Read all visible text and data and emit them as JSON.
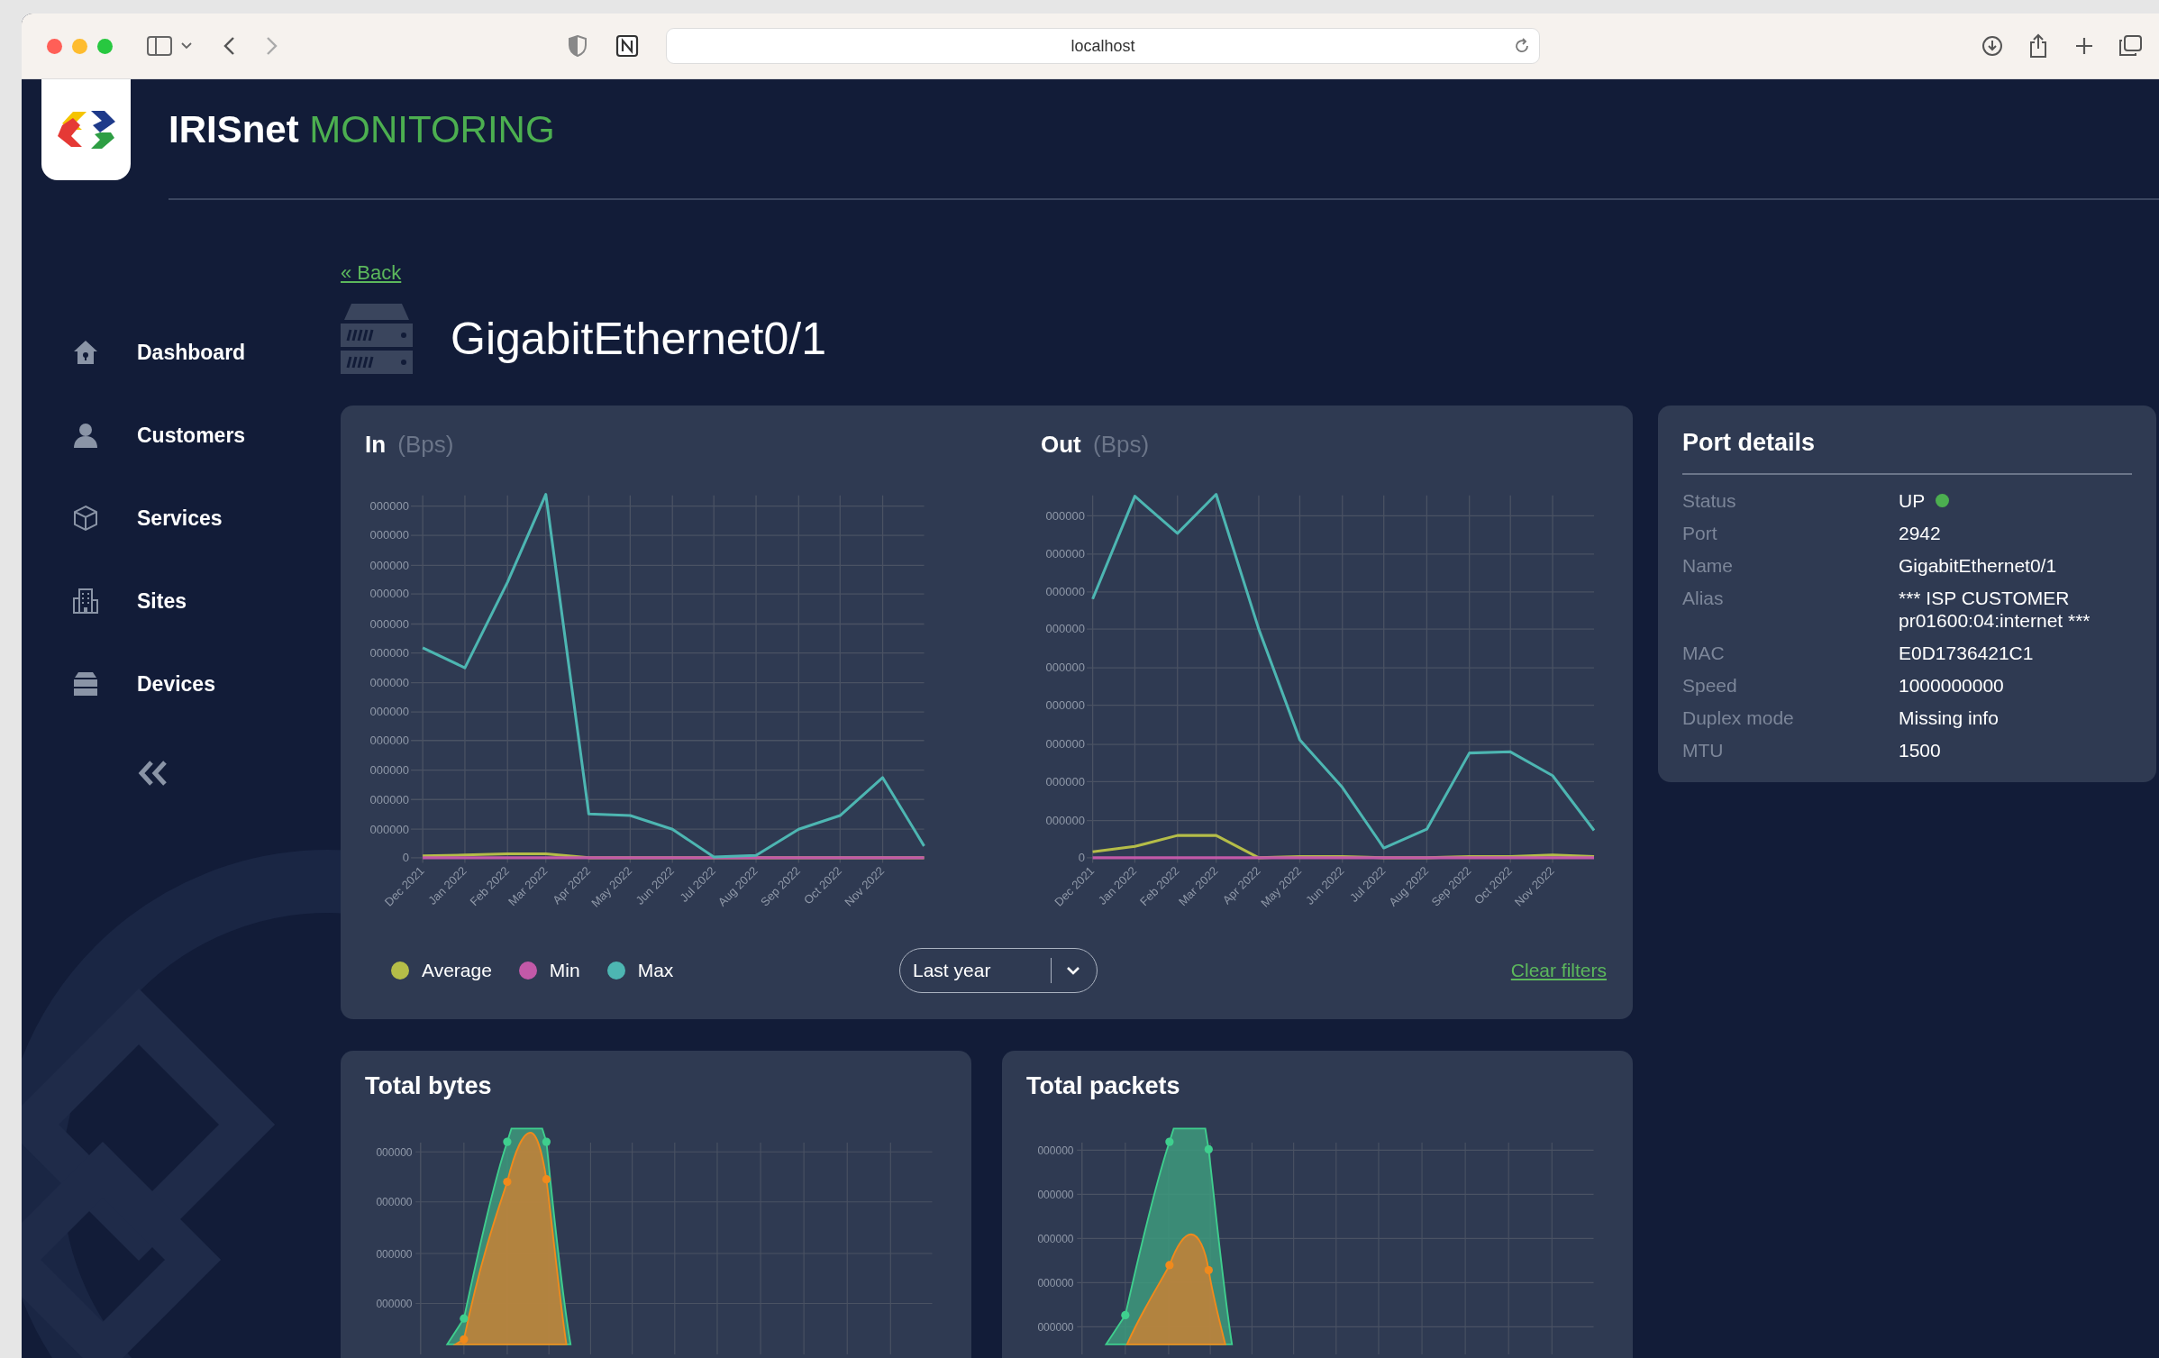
{
  "browser": {
    "address": "localhost"
  },
  "header": {
    "brand": "IRISnet",
    "brand_accent": "MONITORING"
  },
  "sidebar": {
    "items": [
      {
        "label": "Dashboard",
        "kind": "home"
      },
      {
        "label": "Customers",
        "kind": "person"
      },
      {
        "label": "Services",
        "kind": "cube"
      },
      {
        "label": "Sites",
        "kind": "building"
      },
      {
        "label": "Devices",
        "kind": "server"
      }
    ]
  },
  "back_link": "« Back",
  "title": "GigabitEthernet0/1",
  "traffic_card": {
    "charts": [
      {
        "title": "In",
        "unit": "(Bps)",
        "y_labels": [
          "000000",
          "000000",
          "000000",
          "000000",
          "000000",
          "000000",
          "000000",
          "000000",
          "000000",
          "000000",
          "000000",
          "000000",
          "0"
        ],
        "x_labels": [
          "Dec 2021",
          "Jan 2022",
          "Feb 2022",
          "Mar 2022",
          "Apr 2022",
          "May 2022",
          "Jun 2022",
          "Jul 2022",
          "Aug 2022",
          "Sep 2022",
          "Oct 2022",
          "Nov 2022"
        ]
      },
      {
        "title": "Out",
        "unit": "(Bps)",
        "y_labels": [
          "000000",
          "000000",
          "000000",
          "000000",
          "000000",
          "000000",
          "000000",
          "000000",
          "000000",
          "0"
        ],
        "x_labels": [
          "Dec 2021",
          "Jan 2022",
          "Feb 2022",
          "Mar 2022",
          "Apr 2022",
          "May 2022",
          "Jun 2022",
          "Jul 2022",
          "Aug 2022",
          "Sep 2022",
          "Oct 2022",
          "Nov 2022"
        ]
      }
    ],
    "legend": [
      {
        "label": "Average",
        "color": "#b5bd48"
      },
      {
        "label": "Min",
        "color": "#c259a8"
      },
      {
        "label": "Max",
        "color": "#4db6b2"
      }
    ],
    "period_select": {
      "value": "Last year"
    },
    "clear_filters": "Clear filters"
  },
  "port_details": {
    "title": "Port details",
    "rows": [
      {
        "label": "Status",
        "value": "UP",
        "color": "#4caf50"
      },
      {
        "label": "Port",
        "value": "2942"
      },
      {
        "label": "Name",
        "value": "GigabitEthernet0/1"
      },
      {
        "label": "Alias",
        "value": "*** ISP CUSTOMER pr01600:04:internet ***"
      },
      {
        "label": "MAC",
        "value": "E0D1736421C1"
      },
      {
        "label": "Speed",
        "value": "1000000000"
      },
      {
        "label": "Duplex mode",
        "value": "Missing info"
      },
      {
        "label": "MTU",
        "value": "1500"
      }
    ]
  },
  "bottom_cards": [
    {
      "title": "Total bytes",
      "y_labels": [
        "000000",
        "000000",
        "000000",
        "000000"
      ]
    },
    {
      "title": "Total packets",
      "y_labels": [
        "000000",
        "000000",
        "000000",
        "000000",
        "000000"
      ]
    }
  ]
}
